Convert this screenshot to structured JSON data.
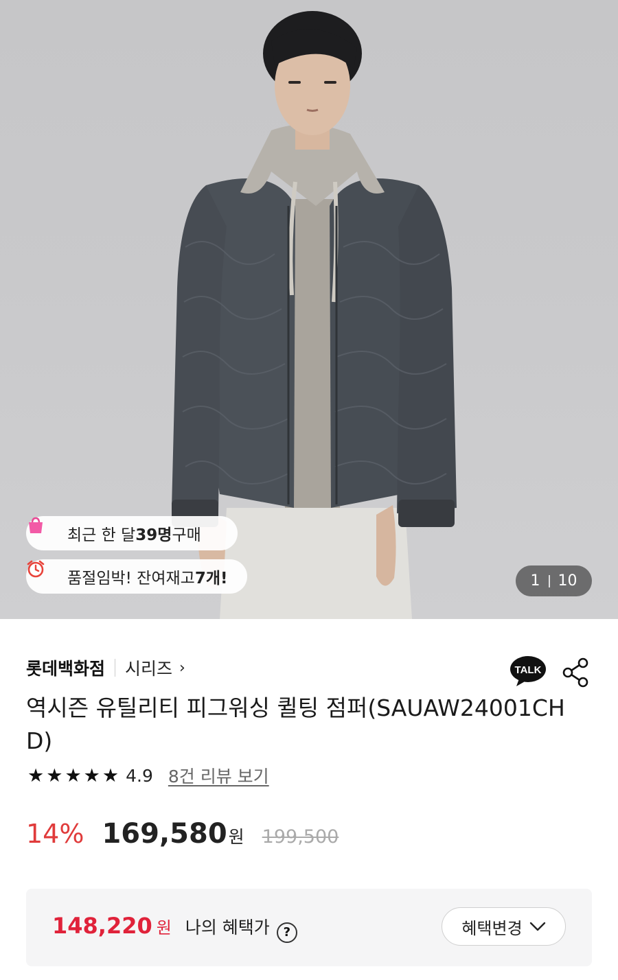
{
  "hero": {
    "badges": {
      "purchase": {
        "prefix": "최근 한 달 ",
        "count": "39명",
        "suffix": " 구매"
      },
      "stock": {
        "prefix": "품절임박! 잔여재고 ",
        "count": "7개!"
      }
    },
    "counter": {
      "current": "1",
      "total": "10"
    }
  },
  "product": {
    "brand": "롯데백화점",
    "series": "시리즈",
    "series_chevron": "›",
    "talk_label": "TALK",
    "title": "역시즌 유틸리티 피그워싱 퀼팅 점퍼(SAUAW24001CHD)",
    "rating": {
      "stars": 5,
      "score": "4.9",
      "review_link": "8건 리뷰 보기"
    },
    "price": {
      "discount": "14%",
      "sale": "169,580",
      "unit": "원",
      "original": "199,500"
    }
  },
  "benefit": {
    "price": "148,220",
    "unit": "원",
    "label": "나의 혜택가",
    "help": "?",
    "button": "혜택변경"
  },
  "colors": {
    "discount": "#e03b3b",
    "benefit_price": "#e0223a",
    "hero_bg": "#c8c8ca"
  }
}
